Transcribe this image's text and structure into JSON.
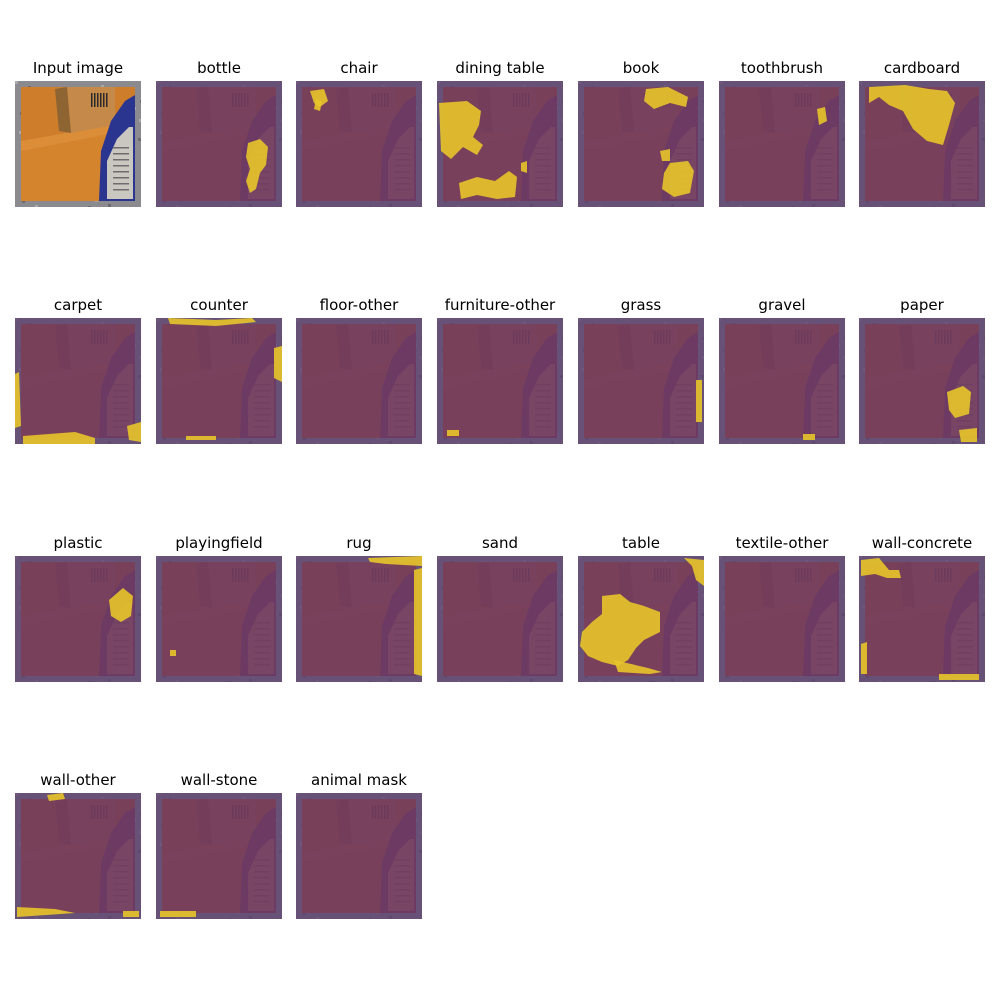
{
  "panels": [
    {
      "title": "Input image",
      "type": "input"
    },
    {
      "title": "bottle",
      "type": "mask",
      "blobs": [
        "bottle"
      ]
    },
    {
      "title": "chair",
      "type": "mask",
      "blobs": [
        "chair"
      ]
    },
    {
      "title": "dining table",
      "type": "mask",
      "blobs": [
        "dining"
      ]
    },
    {
      "title": "book",
      "type": "mask",
      "blobs": [
        "book"
      ]
    },
    {
      "title": "toothbrush",
      "type": "mask",
      "blobs": [
        "toothbrush"
      ]
    },
    {
      "title": "cardboard",
      "type": "mask",
      "blobs": [
        "cardboard"
      ]
    },
    {
      "title": "carpet",
      "type": "mask",
      "blobs": [
        "carpet"
      ]
    },
    {
      "title": "counter",
      "type": "mask",
      "blobs": [
        "counter"
      ]
    },
    {
      "title": "floor-other",
      "type": "mask",
      "blobs": []
    },
    {
      "title": "furniture-other",
      "type": "mask",
      "blobs": [
        "furniture"
      ]
    },
    {
      "title": "grass",
      "type": "mask",
      "blobs": [
        "grass"
      ]
    },
    {
      "title": "gravel",
      "type": "mask",
      "blobs": [
        "gravel"
      ]
    },
    {
      "title": "paper",
      "type": "mask",
      "blobs": [
        "paper"
      ]
    },
    {
      "title": "plastic",
      "type": "mask",
      "blobs": [
        "plastic"
      ]
    },
    {
      "title": "playingfield",
      "type": "mask",
      "blobs": [
        "playingfield"
      ]
    },
    {
      "title": "rug",
      "type": "mask",
      "blobs": [
        "rug"
      ]
    },
    {
      "title": "sand",
      "type": "mask",
      "blobs": []
    },
    {
      "title": "table",
      "type": "mask",
      "blobs": [
        "table"
      ]
    },
    {
      "title": "textile-other",
      "type": "mask",
      "blobs": []
    },
    {
      "title": "wall-concrete",
      "type": "mask",
      "blobs": [
        "wallconcrete"
      ]
    },
    {
      "title": "wall-other",
      "type": "mask",
      "blobs": [
        "wallother"
      ]
    },
    {
      "title": "wall-stone",
      "type": "mask",
      "blobs": [
        "wallstone"
      ]
    },
    {
      "title": "animal mask",
      "type": "mask",
      "blobs": []
    }
  ],
  "colors": {
    "mask_on": "#e8c52a",
    "mask_off_overlay": "#6a3a7a",
    "border_purple": "#5b3d6e",
    "wood": "#d5842e",
    "box": "#c58a4a",
    "bottle": "#2a3590"
  }
}
